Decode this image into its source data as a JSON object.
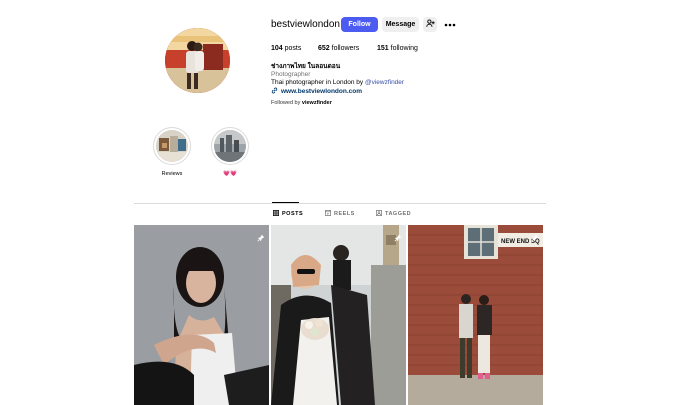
{
  "profile": {
    "username": "bestviewlondon",
    "follow_label": "Follow",
    "message_label": "Message",
    "stats": {
      "posts_count": "104",
      "posts_label": "posts",
      "followers_count": "652",
      "followers_label": "followers",
      "following_count": "151",
      "following_label": "following"
    },
    "bio": {
      "name": "ช่างภาพไทย ในลอนดอน",
      "category": "Photographer",
      "text_prefix": "Thai photographer in London by ",
      "mention": "@viewzfinder",
      "link": "www.bestviewlondon.com",
      "followed_by_prefix": "Followed by ",
      "followed_by_user": "viewzfinder"
    }
  },
  "highlights": [
    {
      "label": "Reviews"
    },
    {
      "label": "💗💗"
    }
  ],
  "tabs": [
    {
      "label": "POSTS",
      "icon": "grid-icon",
      "active": true
    },
    {
      "label": "REELS",
      "icon": "reels-icon",
      "active": false
    },
    {
      "label": "TAGGED",
      "icon": "tag-icon",
      "active": false
    }
  ],
  "posts": [
    {
      "subject": "portrait of a woman in a white tank top, grey background",
      "pinned": true
    },
    {
      "subject": "bride and groom with bouquet near Big Ben",
      "pinned": true
    },
    {
      "subject": "couple on a London street by a brick wall with street sign",
      "pinned": true
    }
  ],
  "post3_sign": "NEW END SQ"
}
